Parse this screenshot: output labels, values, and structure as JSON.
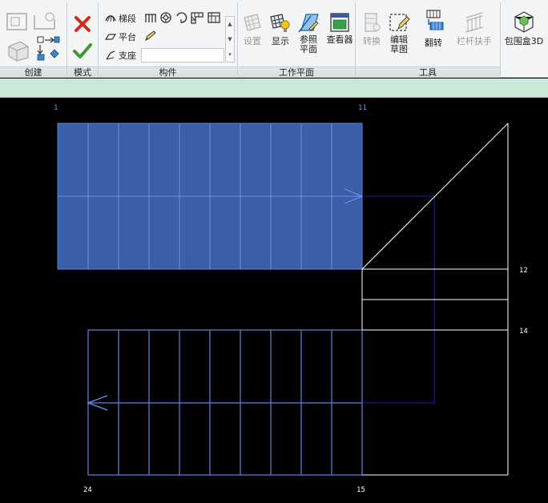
{
  "ribbon": {
    "panels": [
      {
        "label": "创建"
      },
      {
        "label": "模式"
      },
      {
        "label": "构件"
      },
      {
        "label": "工作平面"
      },
      {
        "label": "工具"
      }
    ],
    "component_tools": {
      "run": "梯段",
      "landing": "平台",
      "support": "支座"
    },
    "workplane_tools": {
      "set": "设置",
      "show": "显示",
      "ref_plane_line1": "参照",
      "ref_plane_line2": "平面",
      "viewer": "查看器"
    },
    "tools": {
      "convert": "转换",
      "edit_sketch_line1": "编辑",
      "edit_sketch_line2": "草图",
      "flip": "翻转",
      "railing": "栏杆扶手",
      "section_box": "包围盒3D"
    }
  },
  "canvas": {
    "vertex_labels": {
      "start": "1",
      "top_end": "11",
      "landing_top": "12",
      "landing_bottom": "14",
      "bottom_right": "15",
      "bottom_left": "24"
    }
  },
  "colors": {
    "canvas_bg": "#000000",
    "selected_fill": "#3a5ea8",
    "stair_line": "#5b86e0",
    "boundary_line": "#ffffff",
    "path_line": "#1e1ea8",
    "options_bar": "#c9e8d8",
    "cancel_red": "#d42a1e",
    "finish_green": "#3d9a2e"
  }
}
